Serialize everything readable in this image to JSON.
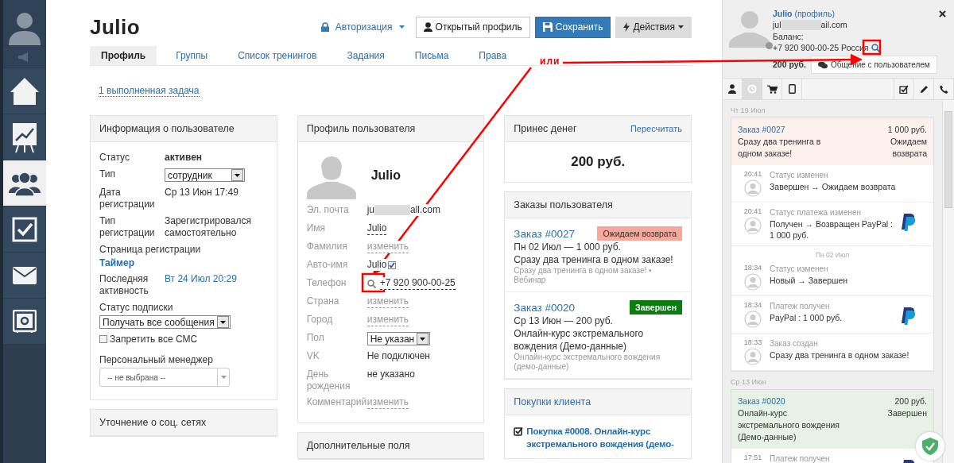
{
  "sidebar": {
    "items": [
      {
        "kind": "avatar",
        "selected": false
      },
      {
        "kind": "speaker",
        "selected": false
      },
      {
        "kind": "home",
        "selected": false
      },
      {
        "kind": "chart",
        "selected": false
      },
      {
        "kind": "users",
        "selected": true
      },
      {
        "kind": "tasks",
        "selected": false
      },
      {
        "kind": "mail",
        "selected": false
      },
      {
        "kind": "safe",
        "selected": false
      }
    ]
  },
  "header": {
    "title": "Julio",
    "auth": "Авторизация",
    "buttons": [
      {
        "kind": "open",
        "label": "Открытый профиль"
      },
      {
        "kind": "save",
        "label": "Сохранить"
      },
      {
        "kind": "actions",
        "label": "Действия"
      }
    ]
  },
  "tabs": [
    {
      "label": "Профиль",
      "selected": true
    },
    {
      "label": "Группы",
      "selected": false
    },
    {
      "label": "Список тренингов",
      "selected": false
    },
    {
      "label": "Задания",
      "selected": false
    },
    {
      "label": "Письма",
      "selected": false
    },
    {
      "label": "Права",
      "selected": false
    }
  ],
  "task_link": "1 выполненная задача",
  "user_info": {
    "title": "Информация о пользователе",
    "rows": [
      {
        "label": "Статус",
        "value": "активен",
        "kind": "bold"
      },
      {
        "label": "Тип",
        "value": "сотрудник",
        "kind": "select"
      },
      {
        "label": "Дата регистрации",
        "value": "Ср 13 Июн 17:49",
        "kind": "text"
      },
      {
        "label": "Тип регистрации",
        "value": "Зарегистрировался самостоятельно",
        "kind": "text"
      },
      {
        "label": "Страница регистрации",
        "value": "Таймер",
        "kind": "stacked-link"
      },
      {
        "label": "Последняя активность",
        "value": "Вт 24 Июл 20:29",
        "kind": "link"
      },
      {
        "label": "Статус подписки",
        "value": "Получать все сообщения",
        "kind": "stacked-select"
      }
    ],
    "sms": {
      "label": "Запретить все СМС",
      "checked": false
    },
    "manager": {
      "label": "Персональный менеджер",
      "placeholder": "-- не выбрана --"
    }
  },
  "social": {
    "title": "Уточнение о соц. сетях"
  },
  "profile": {
    "title": "Профиль пользователя",
    "name": "Julio",
    "rows": [
      {
        "label": "Эл. почта",
        "kind": "email",
        "start": "ju",
        "end": "all.com"
      },
      {
        "label": "Имя",
        "kind": "editable",
        "value": "Julio"
      },
      {
        "label": "Фамилия",
        "kind": "edit-link",
        "value": "изменить"
      },
      {
        "label": "Авто-имя",
        "kind": "checkbox",
        "value": "Julio",
        "checked": true
      },
      {
        "label": "Телефон",
        "kind": "phone",
        "value": "+7 920 900-00-25"
      },
      {
        "label": "Страна",
        "kind": "edit-link",
        "value": "изменить"
      },
      {
        "label": "Город",
        "kind": "edit-link",
        "value": "изменить"
      },
      {
        "label": "Пол",
        "kind": "select",
        "value": "Не указан"
      },
      {
        "label": "VK",
        "kind": "text",
        "value": "Не подключен"
      },
      {
        "label": "День рождения",
        "kind": "text",
        "value": "не указано"
      },
      {
        "label": "Комментарий",
        "kind": "edit-link",
        "value": "изменить"
      }
    ]
  },
  "extra": {
    "title": "Дополнительные поля"
  },
  "money": {
    "title": "Принес денег",
    "action": "Пересчитать",
    "amount": "200 руб."
  },
  "orders": {
    "title": "Заказы пользователя",
    "items": [
      {
        "number": "Заказ #0027",
        "status": "Ожидаем возврата",
        "color": "#f7a899",
        "meta": "Пн 02 Июл — 1 000 руб.",
        "title": "Сразу два тренинга в одном заказе!",
        "subtitle": "Сразу два тренинга в одном заказе! • Вебинар"
      },
      {
        "number": "Заказ #0020",
        "status": "Завершен",
        "color": "#0a7d10",
        "meta": "Ср 13 Июн — 200 руб.",
        "title": "Онлайн-курс экстремального вождения (Демо-данные)",
        "subtitle": "Онлайн-курс экстремального вождения (демо-данные)"
      }
    ]
  },
  "purchases": {
    "title": "Покупки клиента",
    "items": [
      {
        "label": "Покупка #0008. Онлайн-курс экстремального вождения (демо-"
      }
    ]
  },
  "customer": {
    "name": "Julio",
    "profile_link": "(профиль)",
    "online": false,
    "email": {
      "start": "jul",
      "end": "ail.com"
    },
    "balance_label": "Баланс:",
    "phone": "+7 920 900-00-25 Россия",
    "balance": "200 руб.",
    "chat_button": "Общение с пользователем",
    "tabs": [
      {
        "kind": "user",
        "selected": false
      },
      {
        "kind": "history",
        "selected": true
      },
      {
        "kind": "cart",
        "selected": false
      },
      {
        "kind": "tablet",
        "selected": false
      },
      {
        "kind": "tasks",
        "selected": false
      },
      {
        "kind": "pencil",
        "selected": false
      },
      {
        "kind": "phone",
        "selected": false
      }
    ],
    "timeline": [
      {
        "date": "Чт 19 Июл",
        "order": {
          "number": "Заказ #0027",
          "amount": "1 000 руб.",
          "text": "Сразу два тренинга в одном заказе!",
          "status": "Ожидаем возврата",
          "color": "#fdf1ee"
        },
        "entries": [
          {
            "kind": "event",
            "time": "20:41",
            "title": "Статус изменен",
            "text": "Завершен → Ожидаем возврата",
            "paypal": false
          },
          {
            "kind": "event",
            "time": "20:41",
            "title": "Статус платежа изменен",
            "text": "Получен → Возвращен PayPal : 1 000 руб.",
            "paypal": true
          },
          {
            "kind": "date",
            "text": "Пн 02 Июл"
          },
          {
            "kind": "event",
            "time": "18:34",
            "title": "Статус изменен",
            "text": "Новый → Завершен",
            "paypal": false
          },
          {
            "kind": "event",
            "time": "18:34",
            "title": "Платеж получен",
            "text": "PayPal : 1 000 руб.",
            "paypal": true
          },
          {
            "kind": "event",
            "time": "18:33",
            "title": "Заказ создан",
            "text": "Сразу два тренинга в одном заказе!",
            "paypal": false
          }
        ]
      },
      {
        "date": "Ср 13 Июн",
        "order": {
          "number": "Заказ #0020",
          "amount": "200 руб.",
          "text": "Онлайн-курс экстремального вождения (Демо-данные)",
          "status": "Завершен",
          "color": "#e6f2e4"
        },
        "entries": [
          {
            "kind": "event",
            "time": "17:51",
            "title": "Платеж получен",
            "paypal": true
          }
        ]
      }
    ]
  },
  "annotation": {
    "label": "или"
  }
}
